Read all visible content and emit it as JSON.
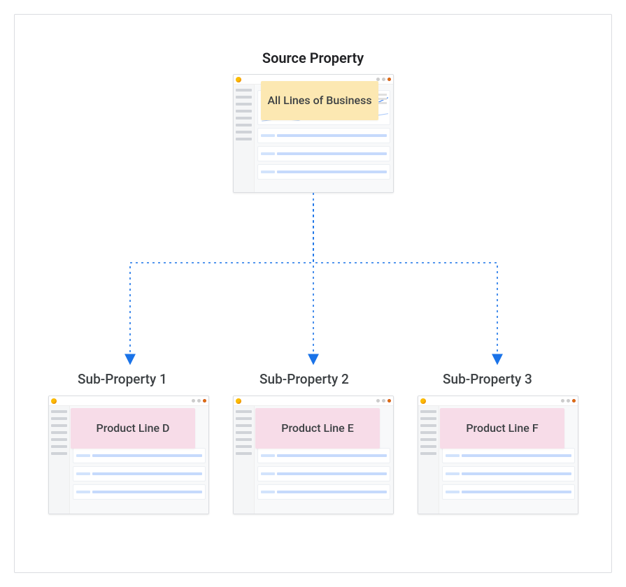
{
  "source": {
    "title": "Source Property",
    "label": "All Lines of Business"
  },
  "subs": [
    {
      "title": "Sub-Property 1",
      "label": "Product Line D"
    },
    {
      "title": "Sub-Property 2",
      "label": "Product Line E"
    },
    {
      "title": "Sub-Property 3",
      "label": "Product Line F"
    }
  ]
}
